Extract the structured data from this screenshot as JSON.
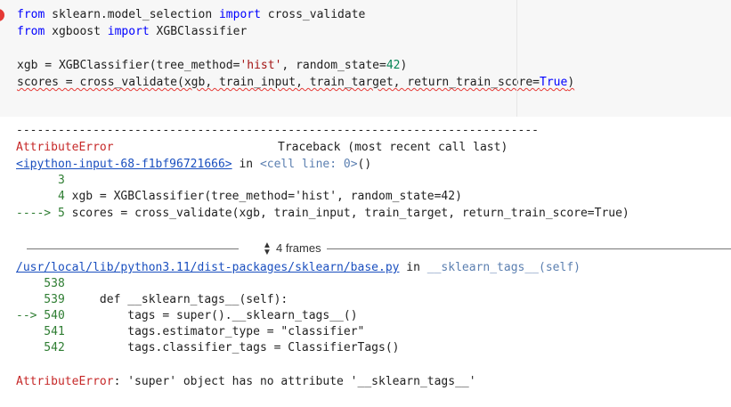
{
  "code": {
    "line1": {
      "kw1": "from",
      "mod": " sklearn.model_selection ",
      "kw2": "import",
      "name": " cross_validate"
    },
    "line2": {
      "kw1": "from",
      "mod": " xgboost ",
      "kw2": "import",
      "name": " XGBClassifier"
    },
    "line4": {
      "pre": "xgb = XGBClassifier(tree_method=",
      "str": "'hist'",
      "mid": ", random_state=",
      "num": "42",
      "post": ")"
    },
    "line5": {
      "pre": "scores = cross_validate(xgb, train_input, train_target, return_train_score=",
      "kw": "True",
      "post": ")"
    }
  },
  "output": {
    "dashes": "---------------------------------------------------------------------------",
    "error_name": "AttributeError",
    "traceback_label": "Traceback (most recent call last)",
    "input_link": "<ipython-input-68-f1bf96721666>",
    "in_word": " in ",
    "cell_line": "<cell line: 0>",
    "cell_parens": "()",
    "tb_lines": [
      {
        "arrow": "      3",
        "code": ""
      },
      {
        "arrow": "      4",
        "code": " xgb = XGBClassifier(tree_method='hist', random_state=42)"
      },
      {
        "arrow": "----> 5",
        "code": " scores = cross_validate(xgb, train_input, train_target, return_train_score=True)"
      }
    ],
    "frames_label": "4 frames",
    "file_link": "/usr/local/lib/python3.11/dist-packages/sklearn/base.py",
    "func_name": "__sklearn_tags__(self)",
    "src_lines": [
      {
        "num": "    538",
        "code": ""
      },
      {
        "num": "    539",
        "code": "     def __sklearn_tags__(self):"
      },
      {
        "num": "--> 540",
        "code": "         tags = super().__sklearn_tags__()"
      },
      {
        "num": "    541",
        "code": "         tags.estimator_type = \"classifier\""
      },
      {
        "num": "    542",
        "code": "         tags.classifier_tags = ClassifierTags()"
      }
    ],
    "final_error_name": "AttributeError",
    "final_error_msg": ": 'super' object has no attribute '__sklearn_tags__'"
  },
  "colors": {
    "error_red": "#c62828",
    "line_green": "#2e7d32",
    "link_blue": "#1a4fbf",
    "keyword_blue": "#0000ff"
  }
}
